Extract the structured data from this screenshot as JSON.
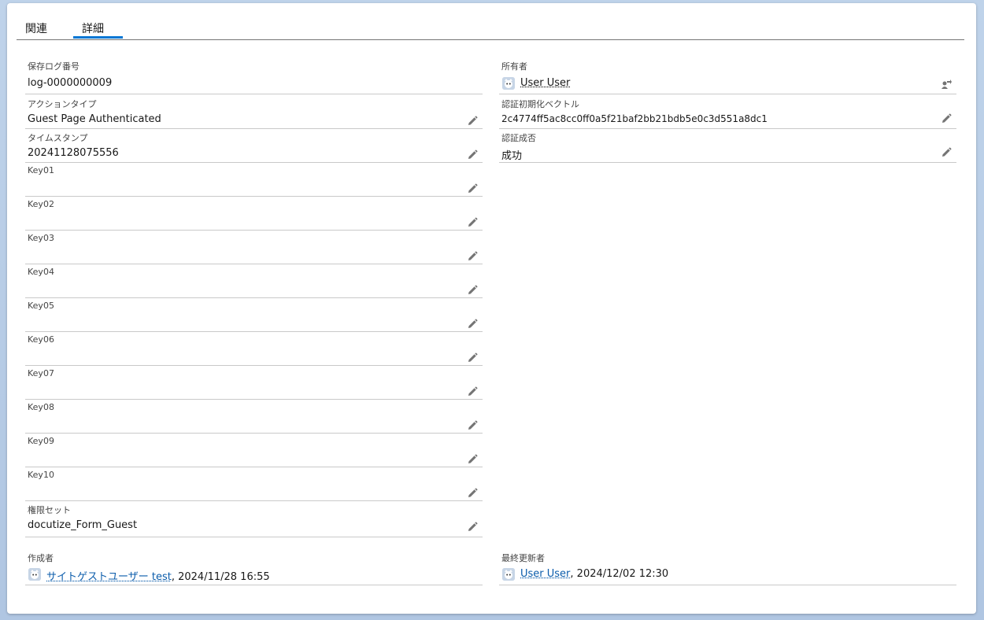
{
  "tabs": {
    "related": "関連",
    "detail": "詳細"
  },
  "left_fields": [
    {
      "label": "保存ログ番号",
      "value": "log-0000000009"
    },
    {
      "label": "アクションタイプ",
      "value": "Guest Page Authenticated"
    },
    {
      "label": "タイムスタンプ",
      "value": "20241128075556"
    },
    {
      "label": "Key01",
      "value": ""
    },
    {
      "label": "Key02",
      "value": ""
    },
    {
      "label": "Key03",
      "value": ""
    },
    {
      "label": "Key04",
      "value": ""
    },
    {
      "label": "Key05",
      "value": ""
    },
    {
      "label": "Key06",
      "value": ""
    },
    {
      "label": "Key07",
      "value": ""
    },
    {
      "label": "Key08",
      "value": ""
    },
    {
      "label": "Key09",
      "value": ""
    },
    {
      "label": "Key10",
      "value": ""
    },
    {
      "label": "権限セット",
      "value": "docutize_Form_Guest"
    }
  ],
  "right_fields": {
    "owner": {
      "label": "所有者",
      "value": "User User"
    },
    "iv": {
      "label": "認証初期化ベクトル",
      "value": "2c4774ff5ac8cc0ff0a5f21baf2bb21bdb5e0c3d551a8dc1"
    },
    "auth": {
      "label": "認証成否",
      "value": "成功"
    }
  },
  "system": {
    "created_by": {
      "label": "作成者",
      "user": "サイトゲストユーザー test",
      "date": ", 2024/11/28 16:55"
    },
    "modified_by": {
      "label": "最終更新者",
      "user": "User User",
      "date": ", 2024/12/02 12:30"
    }
  },
  "icons": {
    "edit": "pencil-icon",
    "change_owner": "change-owner-icon",
    "avatar": "user-avatar-icon"
  },
  "colors": {
    "link": "#0b5cab",
    "tab_active": "#0176d3"
  }
}
